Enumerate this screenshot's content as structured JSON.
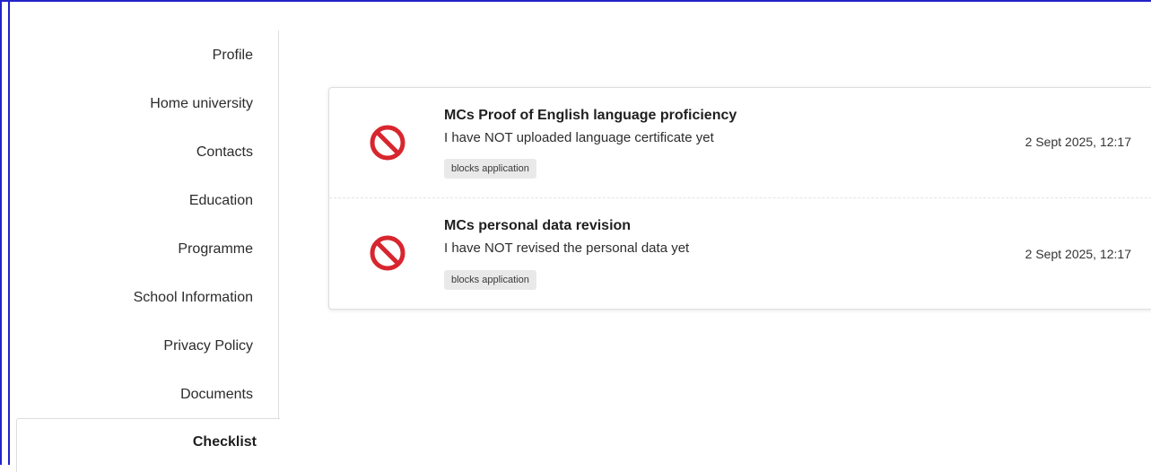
{
  "sidebar": {
    "items": [
      {
        "label": "Profile"
      },
      {
        "label": "Home university"
      },
      {
        "label": "Contacts"
      },
      {
        "label": "Education"
      },
      {
        "label": "Programme"
      },
      {
        "label": "School Information"
      },
      {
        "label": "Privacy Policy"
      },
      {
        "label": "Documents"
      }
    ],
    "active": {
      "label": "Checklist"
    }
  },
  "checklist": {
    "items": [
      {
        "title": "MCs Proof of English language proficiency",
        "description": "I have NOT uploaded language certificate yet",
        "badge": "blocks application",
        "timestamp": "2 Sept 2025, 12:17",
        "status_icon": "prohibited-icon"
      },
      {
        "title": "MCs personal data revision",
        "description": "I have NOT revised the personal data yet",
        "badge": "blocks application",
        "timestamp": "2 Sept 2025, 12:17",
        "status_icon": "prohibited-icon"
      }
    ]
  },
  "colors": {
    "frame": "#2323c8",
    "prohibited": "#d8262e",
    "badge_bg": "#e9e9e9"
  }
}
